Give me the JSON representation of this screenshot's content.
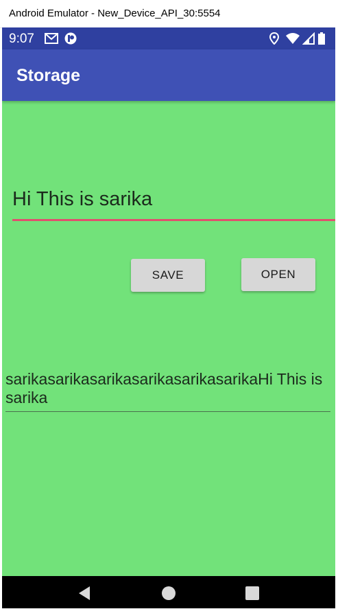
{
  "window": {
    "title": "Android Emulator - New_Device_API_30:5554"
  },
  "status_bar": {
    "time": "9:07",
    "icons": [
      "gmail-icon",
      "app-notification-icon",
      "location-icon",
      "wifi-icon",
      "signal-icon",
      "battery-icon"
    ]
  },
  "app_bar": {
    "title": "Storage",
    "color": "#3f51b5"
  },
  "content": {
    "background": "#72e27a",
    "input_value": "Hi This is sarika",
    "accent": "#e0506e",
    "save_label": "SAVE",
    "open_label": "OPEN",
    "output_text": "sarikasarikasarikasarikasarikasarikaHi This is sarika"
  },
  "nav_bar": {
    "icons": [
      "back-icon",
      "home-icon",
      "recents-icon"
    ]
  }
}
